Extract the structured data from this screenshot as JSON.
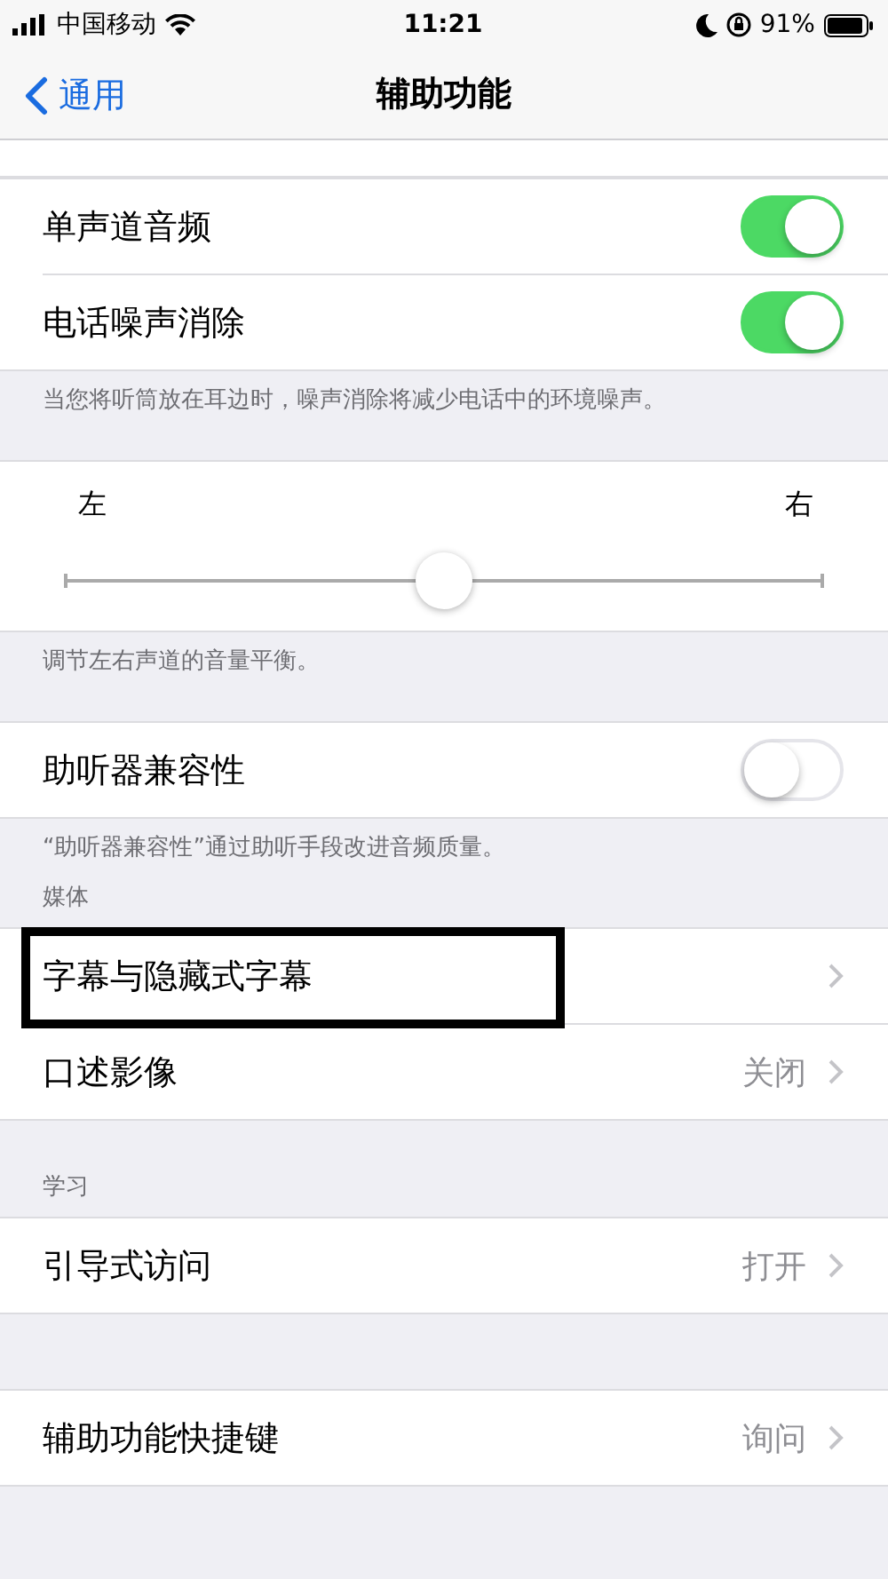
{
  "status_bar": {
    "carrier": "中国移动",
    "time": "11:21",
    "battery": "91%"
  },
  "nav": {
    "back": "通用",
    "title": "辅助功能"
  },
  "sections": [
    {
      "kind": "cutoff"
    },
    {
      "kind": "group",
      "rows": [
        {
          "kind": "toggle",
          "label": "单声道音频",
          "on": true,
          "highlighted": false
        },
        {
          "kind": "toggle",
          "label": "电话噪声消除",
          "on": true,
          "highlighted": false
        }
      ],
      "footer": "当您将听筒放在耳边时，噪声消除将减少电话中的环境噪声。"
    },
    {
      "kind": "balance",
      "left": "左",
      "right": "右",
      "level": 0.5,
      "footer": "调节左右声道的音量平衡。"
    },
    {
      "kind": "group",
      "rows": [
        {
          "kind": "toggle",
          "label": "助听器兼容性",
          "on": false,
          "highlighted": false
        }
      ],
      "footer": "“助听器兼容性”通过助听手段改进音频质量。"
    },
    {
      "kind": "group",
      "header": "媒体",
      "rows": [
        {
          "kind": "link",
          "label": "字幕与隐藏式字幕",
          "highlighted": true
        },
        {
          "kind": "link",
          "label": "口述影像",
          "value": "关闭",
          "highlighted": false
        }
      ]
    },
    {
      "kind": "group",
      "header": "学习",
      "rows": [
        {
          "kind": "link",
          "label": "引导式访问",
          "value": "打开",
          "highlighted": false
        }
      ]
    },
    {
      "kind": "group",
      "rows": [
        {
          "kind": "link",
          "label": "辅助功能快捷键",
          "value": "询问",
          "highlighted": false
        }
      ]
    }
  ]
}
